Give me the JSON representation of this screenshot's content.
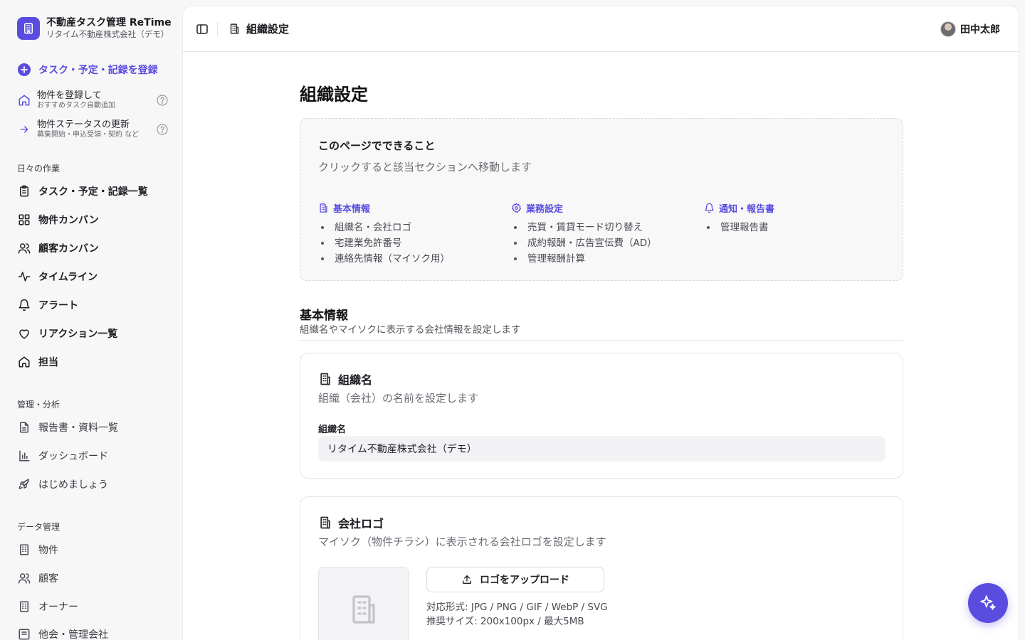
{
  "app": {
    "title": "不動産タスク管理 ReTime",
    "org_name": "リタイム不動産株式会社（デモ）"
  },
  "sidebar": {
    "primary_action": "タスク・予定・記録を登録",
    "quick_links": [
      {
        "label": "物件を登録して",
        "sub": "おすすめタスク自動追加"
      },
      {
        "label": "物件ステータスの更新",
        "sub": "募集開始・申込受領・契約 など"
      }
    ],
    "sections": [
      {
        "label": "日々の作業",
        "items": [
          {
            "label": "タスク・予定・記録一覧",
            "icon": "clipboard-icon"
          },
          {
            "label": "物件カンバン",
            "icon": "grid-icon"
          },
          {
            "label": "顧客カンバン",
            "icon": "users-icon"
          },
          {
            "label": "タイムライン",
            "icon": "activity-icon"
          },
          {
            "label": "アラート",
            "icon": "bell-icon"
          },
          {
            "label": "リアクション一覧",
            "icon": "heart-icon"
          },
          {
            "label": "担当",
            "icon": "home-icon"
          }
        ]
      },
      {
        "label": "管理・分析",
        "items": [
          {
            "label": "報告書・資料一覧",
            "icon": "document-icon"
          },
          {
            "label": "ダッシュボード",
            "icon": "bar-chart-icon"
          },
          {
            "label": "はじめましょう",
            "icon": "rocket-icon"
          }
        ]
      },
      {
        "label": "データ管理",
        "items": [
          {
            "label": "物件",
            "icon": "building-icon"
          },
          {
            "label": "顧客",
            "icon": "users-icon"
          },
          {
            "label": "オーナー",
            "icon": "building-icon"
          },
          {
            "label": "他会・管理会社",
            "icon": "building-icon"
          }
        ]
      }
    ]
  },
  "header": {
    "title": "組織設定",
    "user_name": "田中太郎"
  },
  "page": {
    "title": "組織設定",
    "overview": {
      "title": "このページでできること",
      "subtitle": "クリックすると該当セクションへ移動します",
      "columns": [
        {
          "title": "基本情報",
          "icon": "building-icon",
          "items": [
            "組織名・会社ロゴ",
            "宅建業免許番号",
            "連絡先情報（マイソク用）"
          ]
        },
        {
          "title": "業務設定",
          "icon": "gear-icon",
          "items": [
            "売買・賃貸モード切り替え",
            "成約報酬・広告宣伝費（AD）",
            "管理報酬計算"
          ]
        },
        {
          "title": "通知・報告書",
          "icon": "bell-icon",
          "items": [
            "管理報告書"
          ]
        }
      ]
    },
    "basic_section": {
      "title": "基本情報",
      "description": "組織名やマイソクに表示する会社情報を設定します"
    },
    "org_name_card": {
      "title": "組織名",
      "description": "組織（会社）の名前を設定します",
      "field_label": "組織名",
      "field_value": "リタイム不動産株式会社（デモ）"
    },
    "logo_card": {
      "title": "会社ロゴ",
      "description": "マイソク（物件チラシ）に表示される会社ロゴを設定します",
      "upload_label": "ロゴをアップロード",
      "formats": "対応形式: JPG / PNG / GIF / WebP / SVG",
      "recommended": "推奨サイズ: 200x100px / 最大5MB"
    }
  },
  "colors": {
    "accent": "#5b4ce0",
    "background": "#f7f7f8",
    "surface": "#ffffff"
  }
}
